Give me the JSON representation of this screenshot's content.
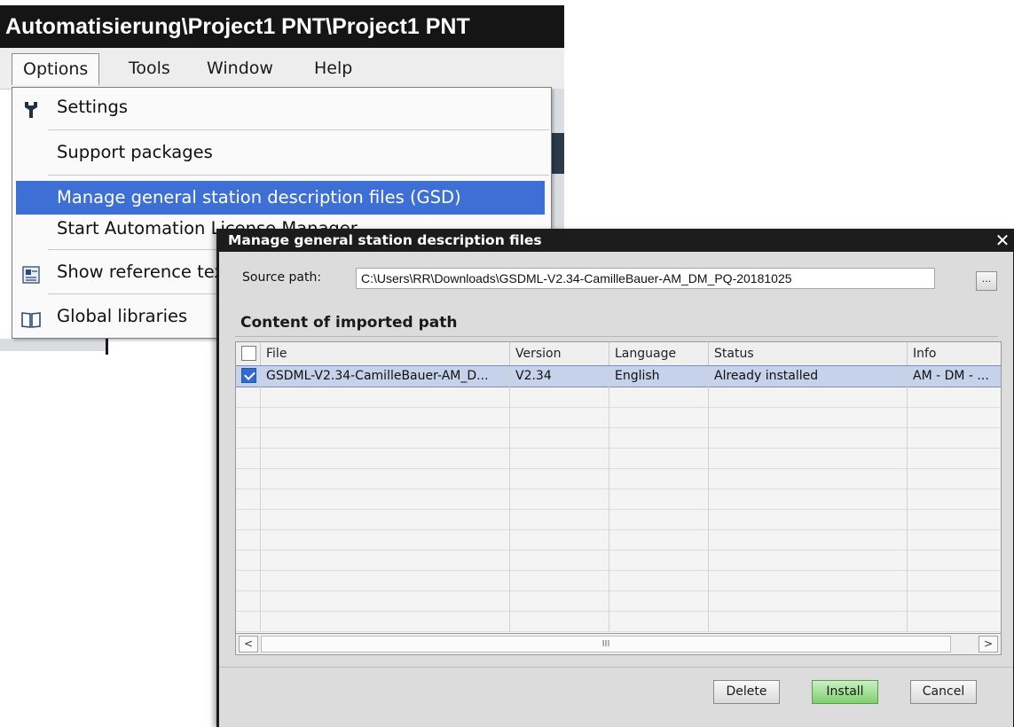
{
  "window": {
    "title": "Automatisierung\\Project1 PNT\\Project1 PNT"
  },
  "menubar": {
    "items": [
      {
        "label": "Options"
      },
      {
        "label": "Tools"
      },
      {
        "label": "Window"
      },
      {
        "label": "Help"
      }
    ]
  },
  "options_menu": {
    "items": [
      {
        "label": "Settings",
        "icon": "wrench-icon"
      },
      {
        "label": "Support packages"
      },
      {
        "label": "Manage general station description files (GSD)",
        "highlighted": true
      },
      {
        "label": "Start Automation License Manager"
      },
      {
        "label": "Show reference text",
        "icon": "reference-text-icon"
      },
      {
        "label": "Global libraries",
        "icon": "book-icon"
      }
    ]
  },
  "dialog": {
    "title": "Manage general station description files",
    "close_glyph": "✕",
    "source_path_label": "Source path:",
    "source_path_value": "C:\\Users\\RR\\Downloads\\GSDML-V2.34-CamilleBauer-AM_DM_PQ-20181025",
    "browse_label": "...",
    "section_title": "Content of imported path",
    "table": {
      "columns": [
        "File",
        "Version",
        "Language",
        "Status",
        "Info"
      ],
      "rows": [
        {
          "checked": true,
          "file": "GSDML-V2.34-CamilleBauer-AM_D...",
          "version": "V2.34",
          "language": "English",
          "status": "Already installed",
          "info": "AM - DM - ..."
        }
      ]
    },
    "scroll": {
      "left": "<",
      "right": ">",
      "grip": "III"
    },
    "buttons": {
      "delete": "Delete",
      "install": "Install",
      "cancel": "Cancel"
    }
  },
  "colors": {
    "menu_highlight": "#3e6fd5",
    "title_bar": "#151515",
    "install_button": "#7fd06f",
    "selected_row": "#c6d2e9"
  }
}
